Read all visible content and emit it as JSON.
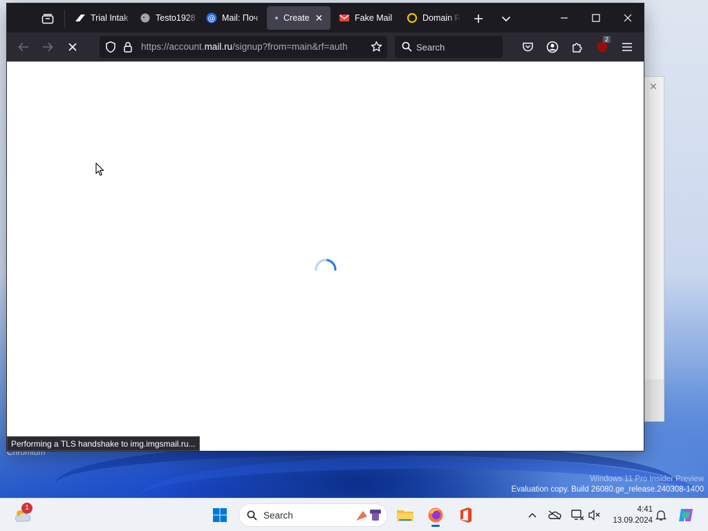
{
  "browser": {
    "tabs": [
      {
        "label": "Trial Intak",
        "icon": "brand-stripe-icon"
      },
      {
        "label": "Testo1928",
        "icon": "elephant-icon"
      },
      {
        "label": "Mail: Поч",
        "icon": "at-sign-icon"
      },
      {
        "label": "Create",
        "icon": "loading-dot-icon",
        "active": true
      },
      {
        "label": "Fake Mail",
        "icon": "envelope-icon"
      },
      {
        "label": "Domain R",
        "icon": "ring-icon"
      }
    ],
    "url": {
      "prefix": "https://account.",
      "host": "mail.ru",
      "path": "/signup?from=main&rf=auth"
    },
    "search_placeholder": "Search",
    "extension_badge": "2",
    "status_text": "Performing a TLS handshake to img.imgsmail.ru..."
  },
  "desktop": {
    "background_window_label": "Chromium",
    "watermark_line1": "Windows 11 Pro Insider Preview",
    "watermark_line2": "Evaluation copy. Build 26080.ge_release.240308-1400"
  },
  "taskbar": {
    "search_label": "Search",
    "weather_badge": "1",
    "time": "4:41",
    "date": "13.09.2024"
  },
  "colors": {
    "accent": "#0067c0",
    "browser_dark": "#1c1b22",
    "spinner": "#2f7de1"
  }
}
